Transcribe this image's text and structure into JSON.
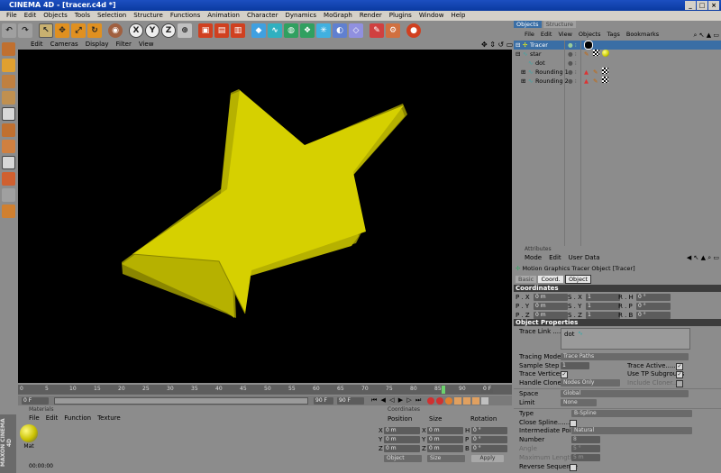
{
  "window": {
    "title": "CINEMA 4D - [tracer.c4d *]",
    "buttons": [
      "_",
      "□",
      "×"
    ]
  },
  "menubar": [
    "File",
    "Edit",
    "Objects",
    "Tools",
    "Selection",
    "Structure",
    "Functions",
    "Animation",
    "Character",
    "Dynamics",
    "MoGraph",
    "Render",
    "Plugins",
    "Window",
    "Help"
  ],
  "toolbar": {
    "axis_labels": [
      "X",
      "Y",
      "Z"
    ]
  },
  "viewport": {
    "menu": [
      "Edit",
      "Cameras",
      "Display",
      "Filter",
      "View"
    ],
    "star_color": "#d6d000"
  },
  "timeline": {
    "ticks": [
      "0",
      "5",
      "10",
      "15",
      "20",
      "25",
      "30",
      "35",
      "40",
      "45",
      "50",
      "55",
      "60",
      "65",
      "70",
      "75",
      "80",
      "85",
      "90"
    ],
    "end_label": "0 F",
    "start_field": "0 F",
    "end_field": "90 F",
    "current_field": "90 F"
  },
  "materials": {
    "header": "Materials",
    "menu": [
      "File",
      "Edit",
      "Function",
      "Texture"
    ],
    "mat_name": "Mat",
    "time": "00:00:00"
  },
  "coordinates": {
    "header": "Coordinates",
    "cols": [
      "Position",
      "Size",
      "Rotation"
    ],
    "rows": [
      {
        "axis": "X",
        "pos": "0 m",
        "size_axis": "X",
        "size": "0 m",
        "rot_axis": "H",
        "rot": "0 °"
      },
      {
        "axis": "Y",
        "pos": "0 m",
        "size_axis": "Y",
        "size": "0 m",
        "rot_axis": "P",
        "rot": "0 °"
      },
      {
        "axis": "Z",
        "pos": "0 m",
        "size_axis": "Z",
        "size": "0 m",
        "rot_axis": "B",
        "rot": "0 °"
      }
    ],
    "mode": "Object",
    "size_mode": "Size",
    "apply": "Apply"
  },
  "objects": {
    "tabs": [
      "Objects",
      "Structure"
    ],
    "menu": [
      "File",
      "Edit",
      "View",
      "Objects",
      "Tags",
      "Bookmarks"
    ],
    "items": [
      {
        "name": "Tracer",
        "indent": 0,
        "color": "#ff0",
        "selected": true
      },
      {
        "name": "star",
        "indent": 0,
        "color": "#cfe",
        "selected": false
      },
      {
        "name": "dot",
        "indent": 1,
        "color": "#cfe",
        "selected": false
      },
      {
        "name": "Rounding 1",
        "indent": 1,
        "color": "#cfe",
        "selected": false
      },
      {
        "name": "Rounding 2",
        "indent": 1,
        "color": "#cfe",
        "selected": false
      }
    ]
  },
  "attributes": {
    "header": "Attributes",
    "menu": [
      "Mode",
      "Edit",
      "User Data"
    ],
    "object_title": "Motion Graphics Tracer Object [Tracer]",
    "tabs": [
      "Basic",
      "Coord.",
      "Object"
    ],
    "coord_header": "Coordinates",
    "coord_rows": [
      {
        "p": "P . X",
        "pv": "0 m",
        "s": "S . X",
        "sv": "1",
        "r": "R . H",
        "rv": "0 °"
      },
      {
        "p": "P . Y",
        "pv": "0 m",
        "s": "S . Y",
        "sv": "1",
        "r": "R . P",
        "rv": "0 °"
      },
      {
        "p": "P . Z",
        "pv": "0 m",
        "s": "S . Z",
        "sv": "1",
        "r": "R . B",
        "rv": "0 °"
      }
    ],
    "props_header": "Object Properties",
    "trace_link_label": "Trace Link .....",
    "trace_link_value": "dot",
    "tracing_mode_label": "Tracing Mode",
    "tracing_mode_value": "Trace Paths",
    "sample_step_label": "Sample Step",
    "sample_step_value": "1",
    "trace_active_label": "Trace Active......",
    "trace_vertices_label": "Trace Vertices",
    "use_tp_label": "Use TP Subgroups",
    "handle_cloners_label": "Handle Cloners",
    "handle_cloners_value": "Nodes Only",
    "include_cloner_label": "Include Cloner.....",
    "space_label": "Space",
    "space_value": "Global",
    "limit_label": "Limit",
    "limit_value": "None",
    "type_label": "Type",
    "type_value": "B-Spline",
    "close_spline_label": "Close Spline......",
    "intermediate_label": "Intermediate Points",
    "intermediate_value": "Natural",
    "number_label": "Number",
    "number_value": "8",
    "angle_label": "Angle",
    "angle_value": "5 °",
    "max_length_label": "Maximum Length",
    "max_length_value": "5 m",
    "reverse_label": "Reverse Sequence"
  },
  "brand": "MAXON CINEMA 4D"
}
